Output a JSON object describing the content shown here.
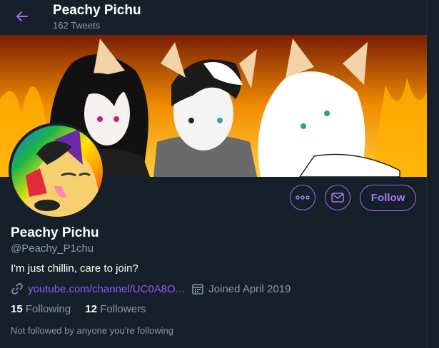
{
  "header": {
    "back_icon": "arrow-left-icon",
    "name": "Peachy Pichu",
    "tweet_count": "162 Tweets"
  },
  "banner": {
    "description_colors": {
      "flames": "#f7a500",
      "dark": "#1a1a1a"
    }
  },
  "profile": {
    "name": "Peachy Pichu",
    "handle": "@Peachy_P1chu",
    "bio": "I'm just chillin, care to join?",
    "link": "youtube.com/channel/UC0A8O...",
    "joined": "Joined April 2019",
    "following_count": "15",
    "following_label": "Following",
    "followers_count": "12",
    "followers_label": "Followers",
    "note": "Not followed by anyone you're following"
  },
  "actions": {
    "more_icon": "more-icon",
    "message_icon": "mail-icon",
    "follow_label": "Follow"
  },
  "colors": {
    "accent": "#9f6bf5",
    "background": "#15202b",
    "muted": "#8899a6"
  }
}
